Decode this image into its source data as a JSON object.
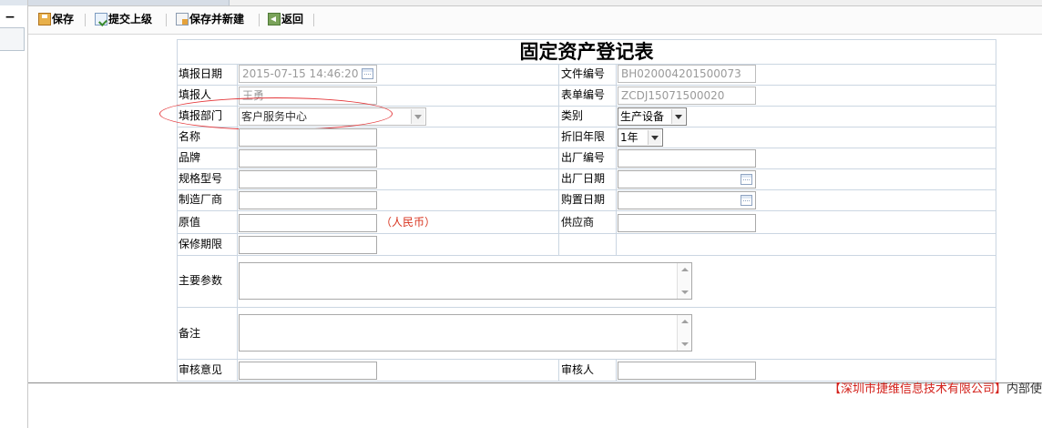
{
  "left_rail": {
    "collapse_glyph": "−"
  },
  "toolbar": {
    "buttons": [
      {
        "label": "保存",
        "icon": "save-icon"
      },
      {
        "label": "提交上级",
        "icon": "submit-icon"
      },
      {
        "label": "保存并新建",
        "icon": "save-new-icon"
      },
      {
        "label": "返回",
        "icon": "back-icon"
      }
    ]
  },
  "form": {
    "title": "固定资产登记表",
    "fill_date": {
      "label": "填报日期",
      "value": "2015-07-15 14:46:20"
    },
    "doc_no": {
      "label": "文件编号",
      "value": "BH020004201500073"
    },
    "filler": {
      "label": "填报人",
      "value": "王勇"
    },
    "form_no": {
      "label": "表单编号",
      "value": "ZCDJ15071500020"
    },
    "department": {
      "label": "填报部门",
      "value": "客户服务中心"
    },
    "category": {
      "label": "类别",
      "value": "生产设备"
    },
    "name": {
      "label": "名称",
      "value": ""
    },
    "depreciation": {
      "label": "折旧年限",
      "value": "1年"
    },
    "brand": {
      "label": "品牌",
      "value": ""
    },
    "serial_no": {
      "label": "出厂编号",
      "value": ""
    },
    "model": {
      "label": "规格型号",
      "value": ""
    },
    "mfg_date": {
      "label": "出厂日期",
      "value": ""
    },
    "manufacturer": {
      "label": "制造厂商",
      "value": ""
    },
    "purchase_date": {
      "label": "购置日期",
      "value": ""
    },
    "original_value": {
      "label": "原值",
      "value": "",
      "unit_note": "（人民币）"
    },
    "supplier": {
      "label": "供应商",
      "value": ""
    },
    "warranty": {
      "label": "保修期限",
      "value": ""
    },
    "main_params": {
      "label": "主要参数",
      "value": ""
    },
    "remarks": {
      "label": "备注",
      "value": ""
    },
    "review_opinion": {
      "label": "审核意见",
      "value": ""
    },
    "reviewer": {
      "label": "审核人",
      "value": ""
    }
  },
  "footer": {
    "company": "【深圳市捷维信息技术有限公司】",
    "suffix": "内部使"
  },
  "colors": {
    "accent_red": "#d3201a",
    "grid": "#cbd6e2",
    "highlight_ellipse": "#e4393c"
  }
}
